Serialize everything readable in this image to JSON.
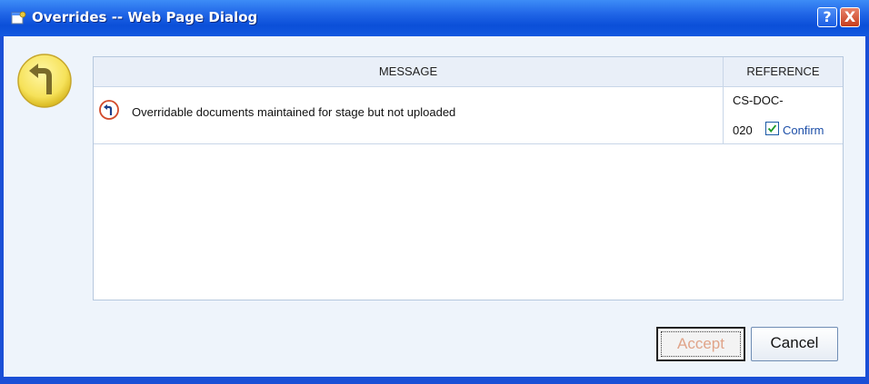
{
  "window": {
    "title": "Overrides -- Web Page Dialog",
    "help_label": "?",
    "close_label": "X"
  },
  "grid": {
    "columns": [
      "MESSAGE",
      "REFERENCE"
    ],
    "rows": [
      {
        "message": "Overridable documents maintained for stage but not uploaded",
        "reference_line1": "CS-DOC-",
        "reference_line2": "020",
        "confirm_label": "Confirm",
        "confirm_checked": true
      }
    ]
  },
  "buttons": {
    "accept": "Accept",
    "cancel": "Cancel"
  },
  "icons": {
    "title_icon": "dialog-page-icon",
    "override_icon": "turn-left-sign-icon",
    "row_icon": "turn-left-sign-icon"
  },
  "colors": {
    "titlebar": "#1f64e6",
    "accent_link": "#1d4fa8",
    "override_badge": "#f5e45a"
  }
}
